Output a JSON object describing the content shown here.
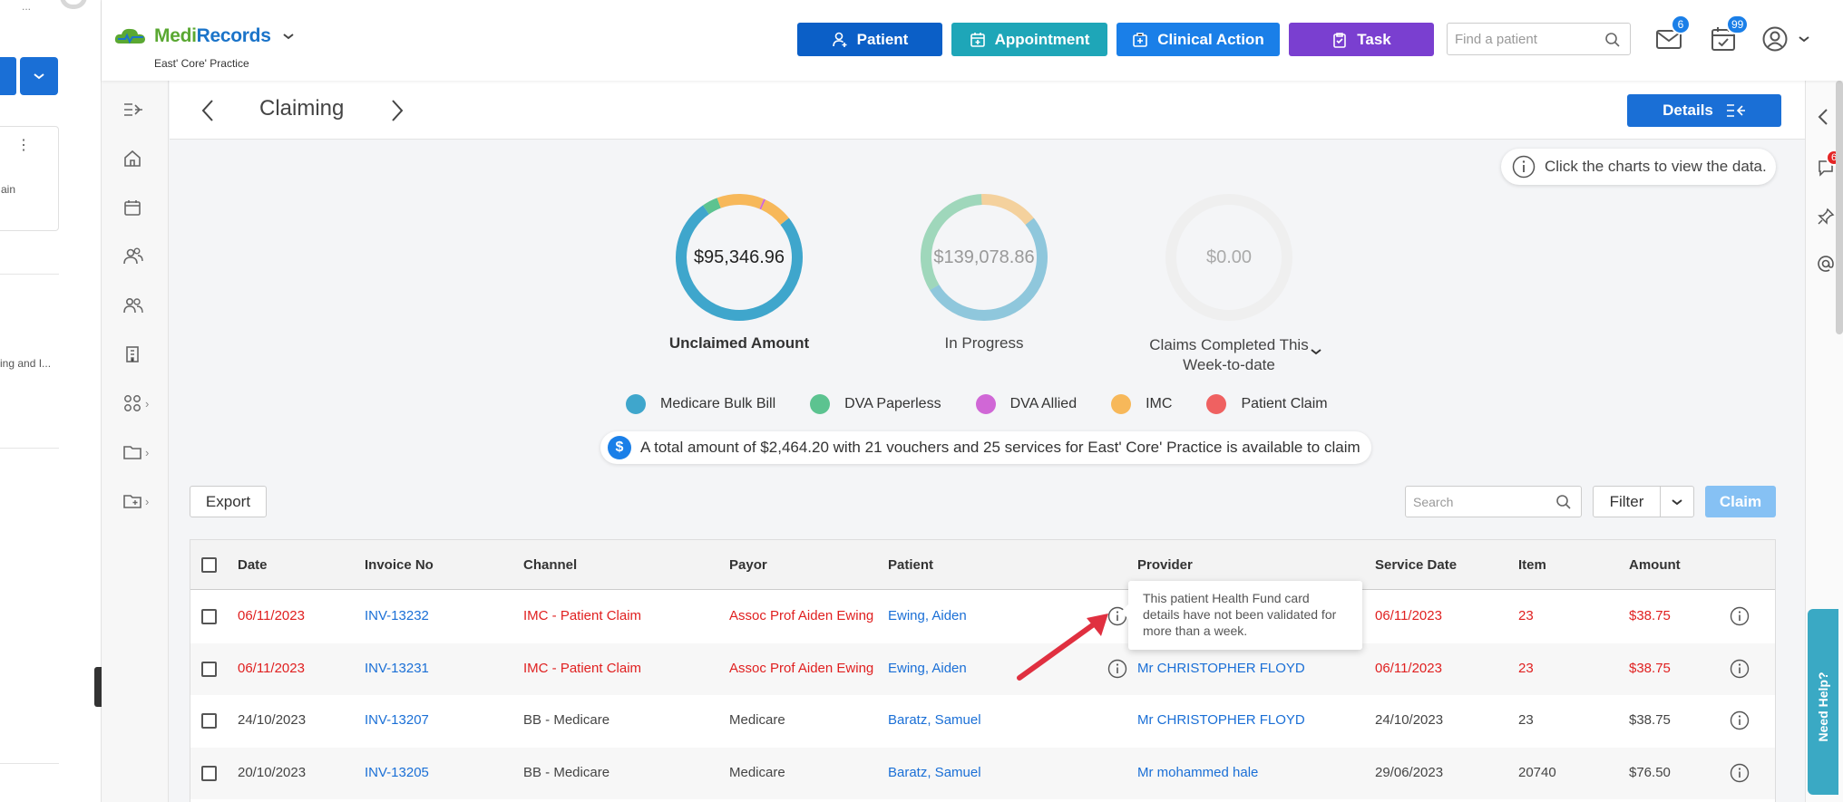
{
  "app": {
    "name_part1": "Medi",
    "name_part2": "Records",
    "practice": "East' Core' Practice"
  },
  "ghost": {
    "dots": "...",
    "card_label": "ain",
    "item_text": "ing and I..."
  },
  "header": {
    "buttons": [
      {
        "label": "Patient",
        "color": "#0b5fc7"
      },
      {
        "label": "Appointment",
        "color": "#1ea6b8"
      },
      {
        "label": "Clinical Action",
        "color": "#1a7fe8"
      },
      {
        "label": "Task",
        "color": "#7a3fd0"
      }
    ],
    "find_placeholder": "Find a patient",
    "mail_badge": "6",
    "tasks_badge": "99"
  },
  "page": {
    "title": "Claiming",
    "details_label": "Details",
    "hint": "Click the charts to view the data."
  },
  "charts": [
    {
      "value": "$95,346.96",
      "label": "Unclaimed Amount",
      "segments": [
        {
          "series": "Medicare Bulk Bill",
          "fraction": 0.76
        },
        {
          "series": "DVA Paperless",
          "fraction": 0.04
        },
        {
          "series": "IMC",
          "fraction": 0.12
        },
        {
          "series": "DVA Allied",
          "fraction": 0.005
        },
        {
          "series": "IMC",
          "fraction": 0.075
        }
      ]
    },
    {
      "value": "$139,078.86",
      "label": "In Progress",
      "segments": [
        {
          "series": "Medicare Bulk Bill",
          "fraction": 0.52
        },
        {
          "series": "DVA Paperless",
          "fraction": 0.33
        },
        {
          "series": "IMC",
          "fraction": 0.15
        }
      ]
    },
    {
      "value": "$0.00",
      "label_line1": "Claims Completed This",
      "label_line2": "Week-to-date",
      "segments": []
    }
  ],
  "legend": [
    {
      "name": "Medicare Bulk Bill",
      "color": "#3fa6cc"
    },
    {
      "name": "DVA Paperless",
      "color": "#5cc390"
    },
    {
      "name": "DVA Allied",
      "color": "#d067d6"
    },
    {
      "name": "IMC",
      "color": "#f7b85a"
    },
    {
      "name": "Patient Claim",
      "color": "#ef6161"
    }
  ],
  "summary": {
    "icon": "$",
    "text": "A total amount of $2,464.20 with 21 vouchers and 25 services for East' Core' Practice is available to claim"
  },
  "toolbar": {
    "export_label": "Export",
    "search_placeholder": "Search",
    "filter_label": "Filter",
    "claim_label": "Claim"
  },
  "table": {
    "headers": [
      "Date",
      "Invoice No",
      "Channel",
      "Payor",
      "Patient",
      "Provider",
      "Service Date",
      "Item",
      "Amount"
    ],
    "rows": [
      {
        "date": "06/11/2023",
        "invoice": "INV-13232",
        "channel": "IMC - Patient Claim",
        "payor": "Assoc Prof Aiden Ewing",
        "patient": "Ewing, Aiden",
        "provider": "",
        "service_date": "06/11/2023",
        "item": "23",
        "amount": "$38.75",
        "highlight": true
      },
      {
        "date": "06/11/2023",
        "invoice": "INV-13231",
        "channel": "IMC - Patient Claim",
        "payor": "Assoc Prof Aiden Ewing",
        "patient": "Ewing, Aiden",
        "provider": "Mr CHRISTOPHER FLOYD",
        "service_date": "06/11/2023",
        "item": "23",
        "amount": "$38.75",
        "highlight": true
      },
      {
        "date": "24/10/2023",
        "invoice": "INV-13207",
        "channel": "BB - Medicare",
        "payor": "Medicare",
        "patient": "Baratz, Samuel",
        "provider": "Mr CHRISTOPHER FLOYD",
        "service_date": "24/10/2023",
        "item": "23",
        "amount": "$38.75",
        "highlight": false
      },
      {
        "date": "20/10/2023",
        "invoice": "INV-13205",
        "channel": "BB - Medicare",
        "payor": "Medicare",
        "patient": "Baratz, Samuel",
        "provider": "Mr mohammed hale",
        "service_date": "29/06/2023",
        "item": "20740",
        "amount": "$76.50",
        "highlight": false
      }
    ]
  },
  "tooltip": {
    "text": "This patient Health Fund card details have not been validated for more than a week."
  },
  "right_strip": {
    "chat_badge": "6",
    "need_help": "Need Help?"
  }
}
